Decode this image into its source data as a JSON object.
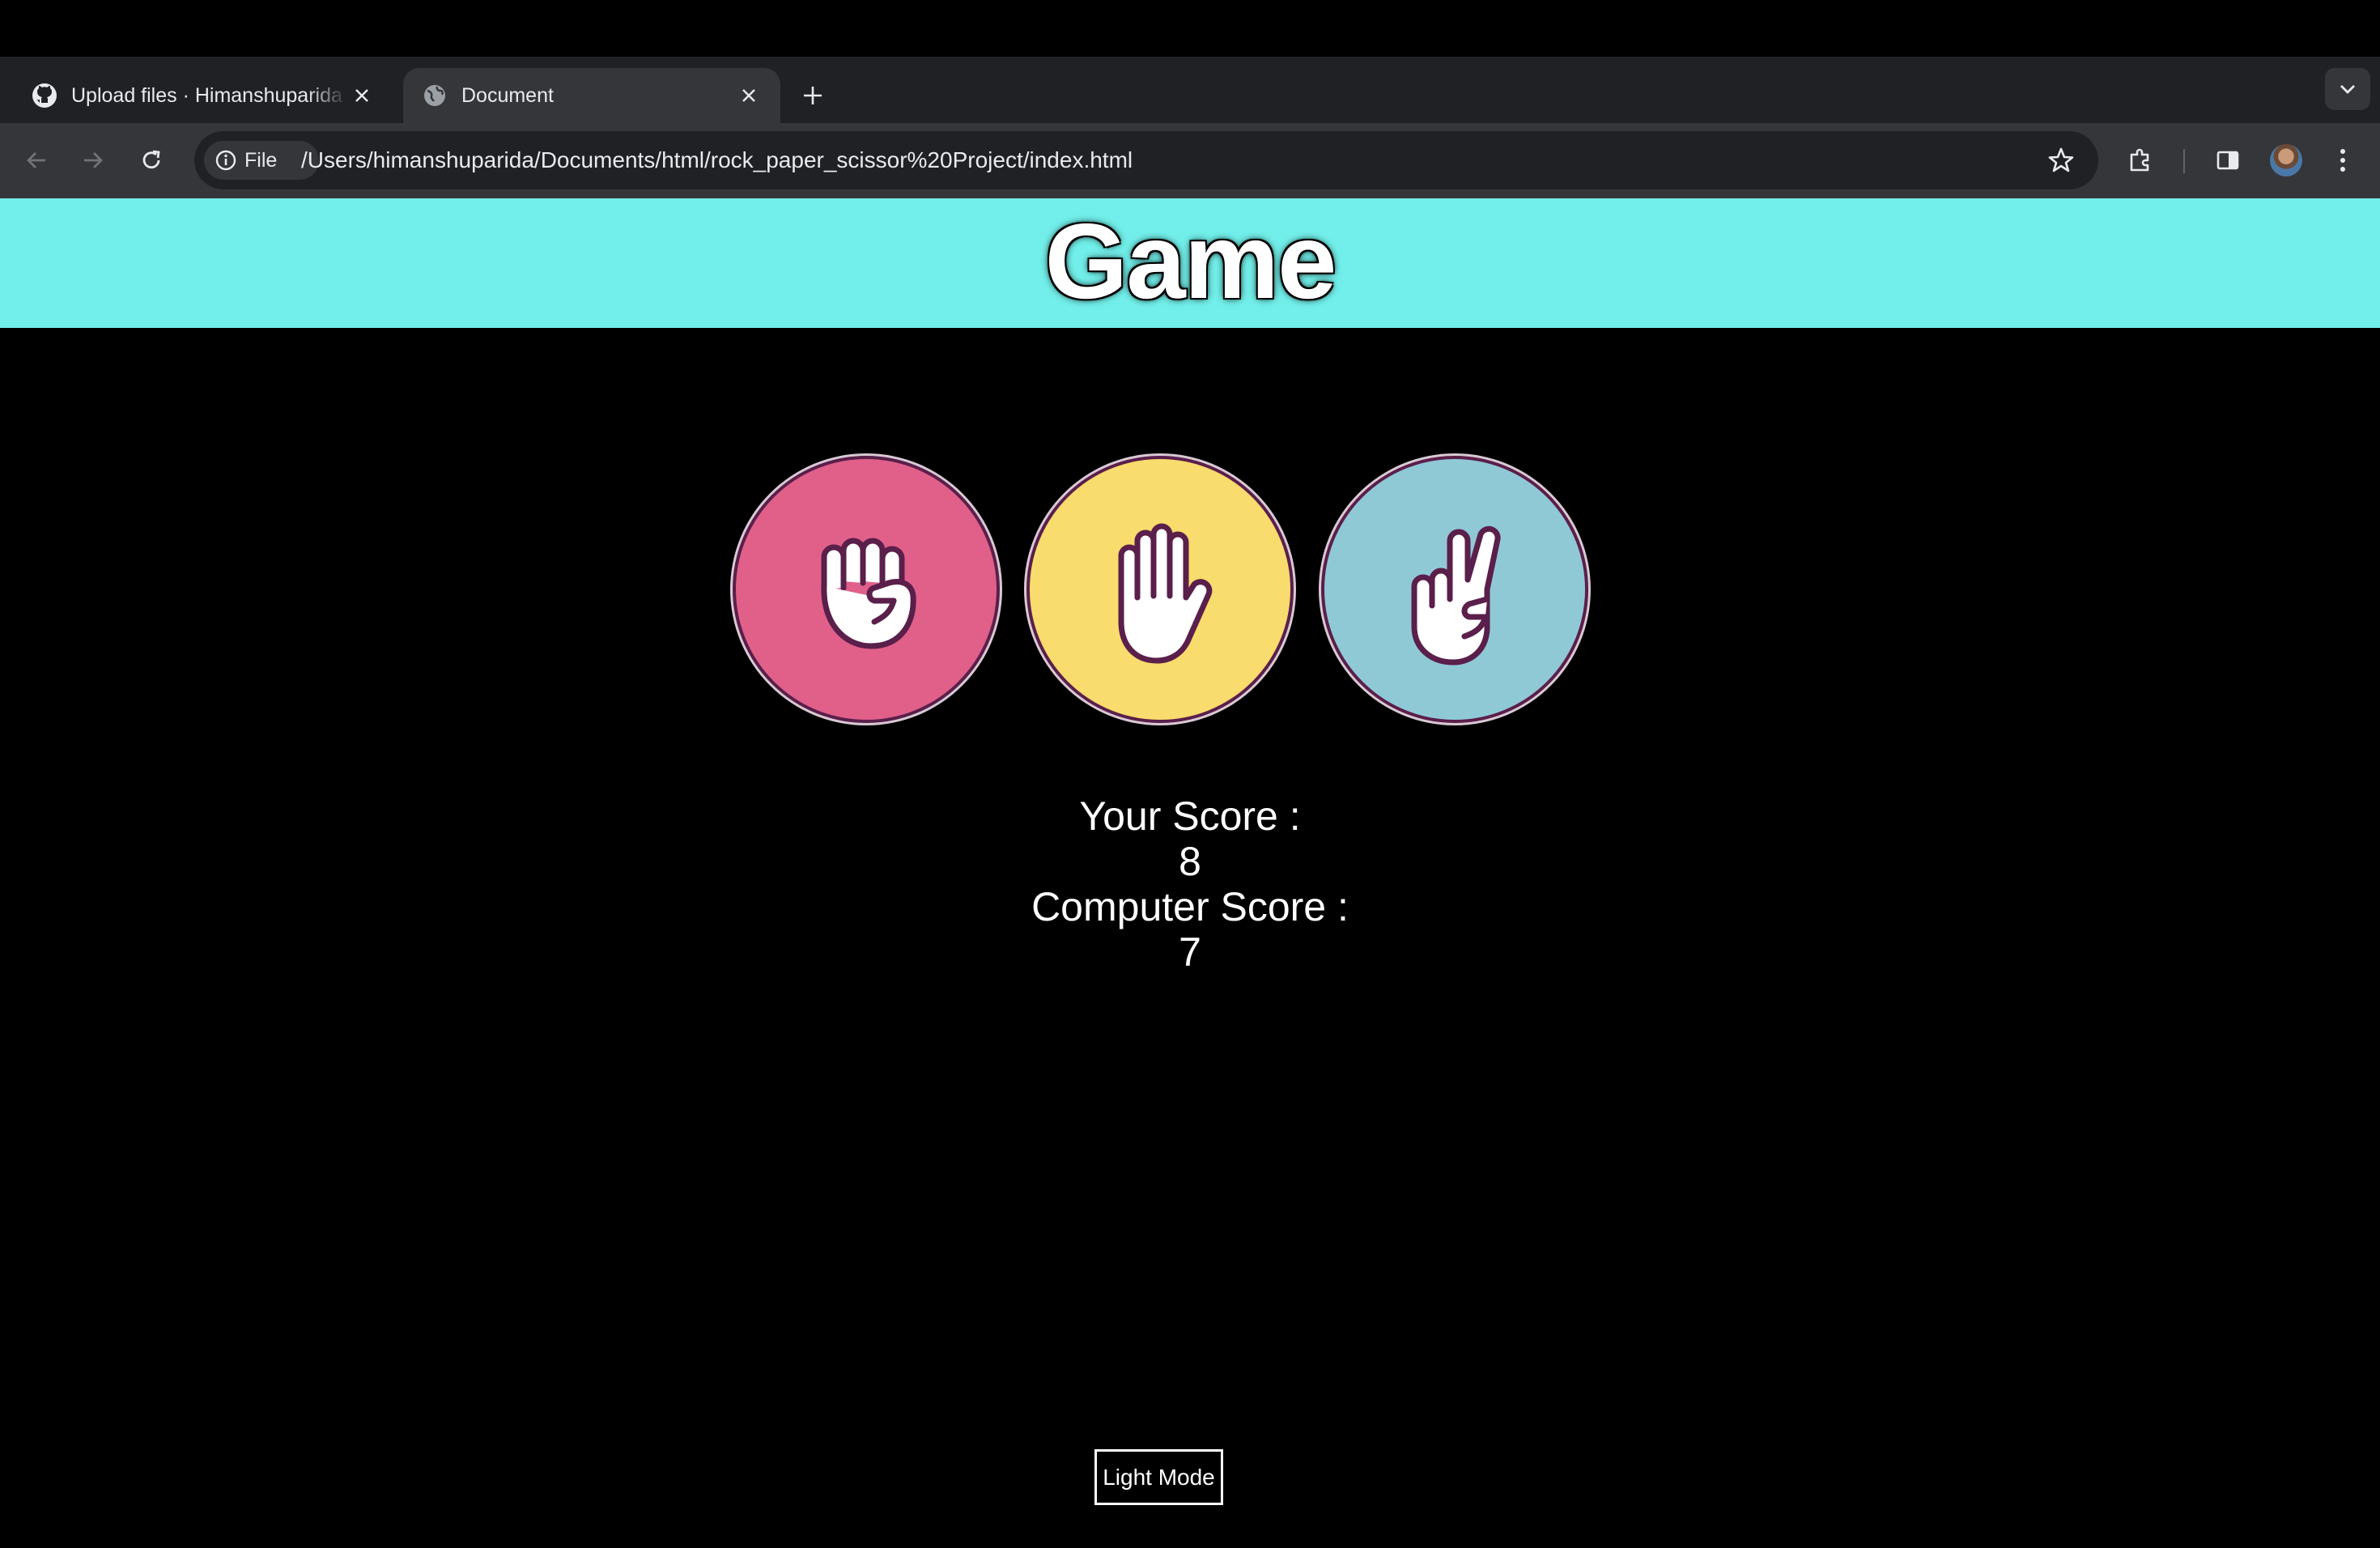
{
  "browser": {
    "tabs": [
      {
        "title": "Upload files · Himanshuparida",
        "favicon": "github-icon",
        "active": false
      },
      {
        "title": "Document",
        "favicon": "globe-icon",
        "active": true
      }
    ],
    "address_bar": {
      "chip_label": "File",
      "url": "/Users/himanshuparida/Documents/html/rock_paper_scissor%20Project/index.html"
    }
  },
  "page": {
    "title": "Game",
    "choices": [
      {
        "name": "rock",
        "color": "#e0608a",
        "icon": "fist-icon"
      },
      {
        "name": "paper",
        "color": "#f8dc6d",
        "icon": "open-hand-icon"
      },
      {
        "name": "scissors",
        "color": "#90c9d6",
        "icon": "peace-hand-icon"
      }
    ],
    "scores": {
      "user_label": "Your Score :",
      "user_value": "8",
      "computer_label": "Computer Score :",
      "computer_value": "7"
    },
    "mode_button_label": "Light Mode"
  },
  "colors": {
    "header_bg": "#72efea",
    "page_bg": "#000000",
    "hand_outline": "#5a1f4a"
  }
}
